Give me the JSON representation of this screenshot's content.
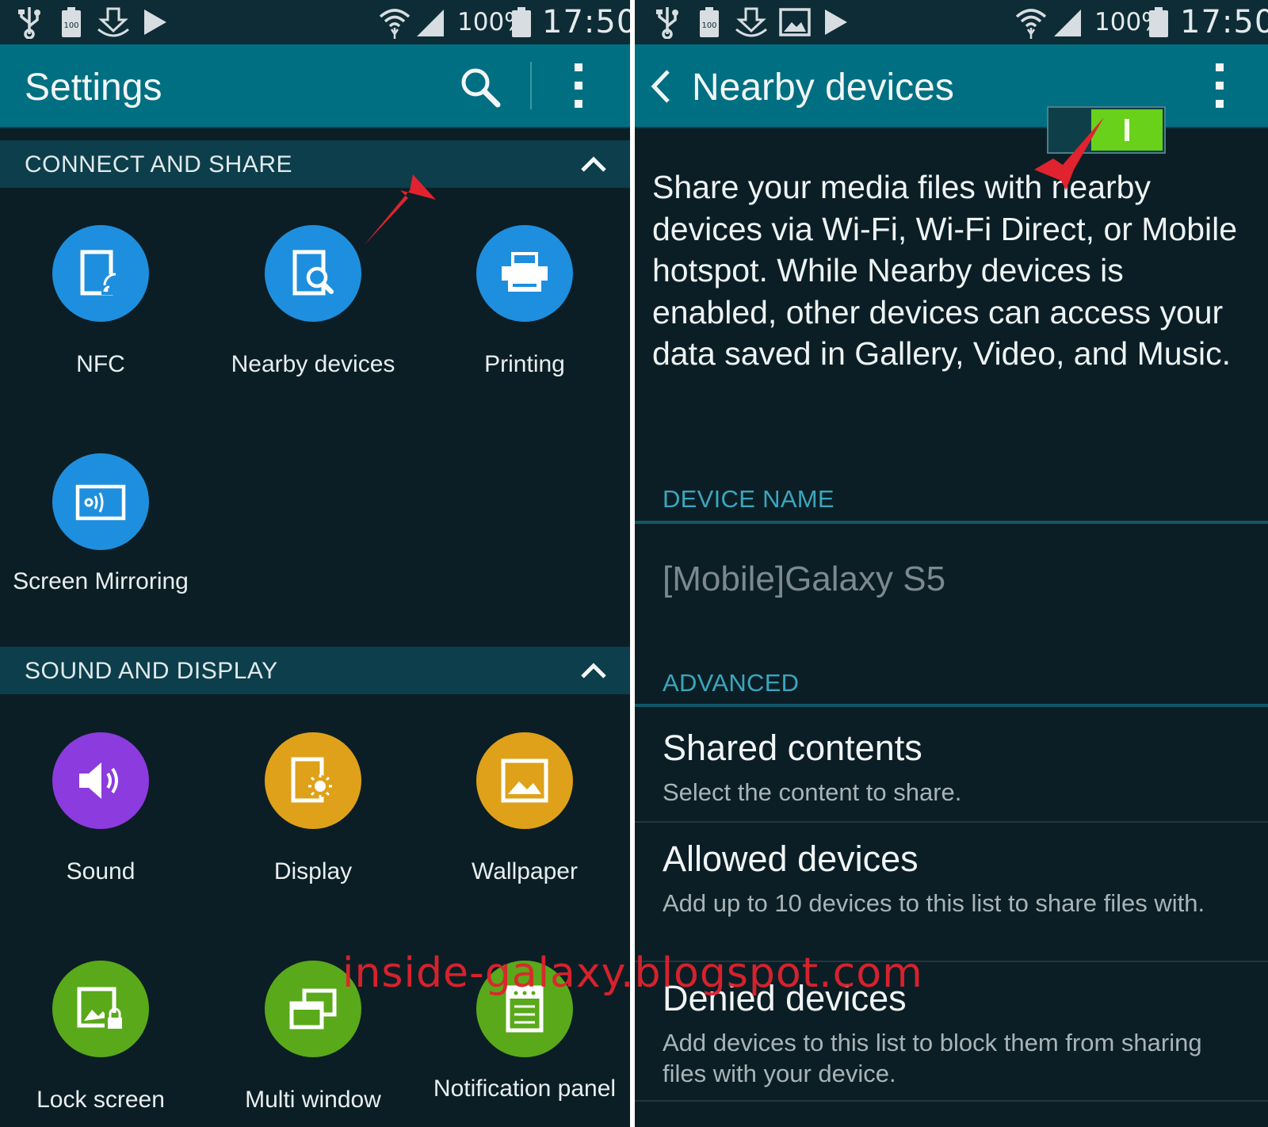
{
  "status_bar": {
    "battery_percent": "100%",
    "time": "17:50",
    "battery_icon_text": "100",
    "icons_left": [
      "usb-icon",
      "battery-saver-icon",
      "download-icon",
      "play-store-icon"
    ],
    "icons_left_right_panel": [
      "usb-icon",
      "battery-saver-icon",
      "download-icon",
      "gallery-icon",
      "play-store-icon"
    ]
  },
  "settings_screen": {
    "title": "Settings",
    "sections": [
      {
        "title": "CONNECT AND SHARE",
        "items": [
          {
            "label": "NFC",
            "icon": "nfc-icon",
            "color": "#1e8fde"
          },
          {
            "label": "Nearby devices",
            "icon": "nearby-devices-icon",
            "color": "#1e8fde"
          },
          {
            "label": "Printing",
            "icon": "printer-icon",
            "color": "#1e8fde"
          },
          {
            "label": "Screen Mirroring",
            "icon": "screen-mirroring-icon",
            "color": "#1e8fde"
          }
        ]
      },
      {
        "title": "SOUND AND DISPLAY",
        "items": [
          {
            "label": "Sound",
            "icon": "speaker-icon",
            "color": "#8c3bde"
          },
          {
            "label": "Display",
            "icon": "display-icon",
            "color": "#dfa11a"
          },
          {
            "label": "Wallpaper",
            "icon": "wallpaper-icon",
            "color": "#dfa11a"
          },
          {
            "label": "Lock screen",
            "icon": "lock-screen-icon",
            "color": "#59a91a"
          },
          {
            "label": "Multi window",
            "icon": "multi-window-icon",
            "color": "#59a91a"
          },
          {
            "label": "Notification panel",
            "icon": "notification-panel-icon",
            "color": "#59a91a"
          }
        ]
      }
    ]
  },
  "nearby_screen": {
    "title": "Nearby devices",
    "toggle_on": true,
    "description": "Share your media files with nearby devices via Wi-Fi, Wi-Fi Direct, or Mobile hotspot. While Nearby devices is enabled, other devices can access your data saved in Gallery, Video, and Music.",
    "device_name_header": "DEVICE NAME",
    "device_name": "[Mobile]Galaxy S5",
    "advanced_header": "ADVANCED",
    "preferences": [
      {
        "title": "Shared contents",
        "summary": "Select the content to share."
      },
      {
        "title": "Allowed devices",
        "summary": "Add up to 10 devices to this list to share files with."
      },
      {
        "title": "Denied devices",
        "summary": "Add devices to this list to block them from sharing files with your device."
      }
    ]
  },
  "watermark": "inside-galaxy.blogspot.com",
  "colors": {
    "action_bar": "#006f82",
    "section_header": "#0c3e4b",
    "background": "#0c1e25",
    "accent_text": "#3aa6bd",
    "toggle_on": "#6ad11a",
    "annotation_arrow": "#e0232e"
  }
}
